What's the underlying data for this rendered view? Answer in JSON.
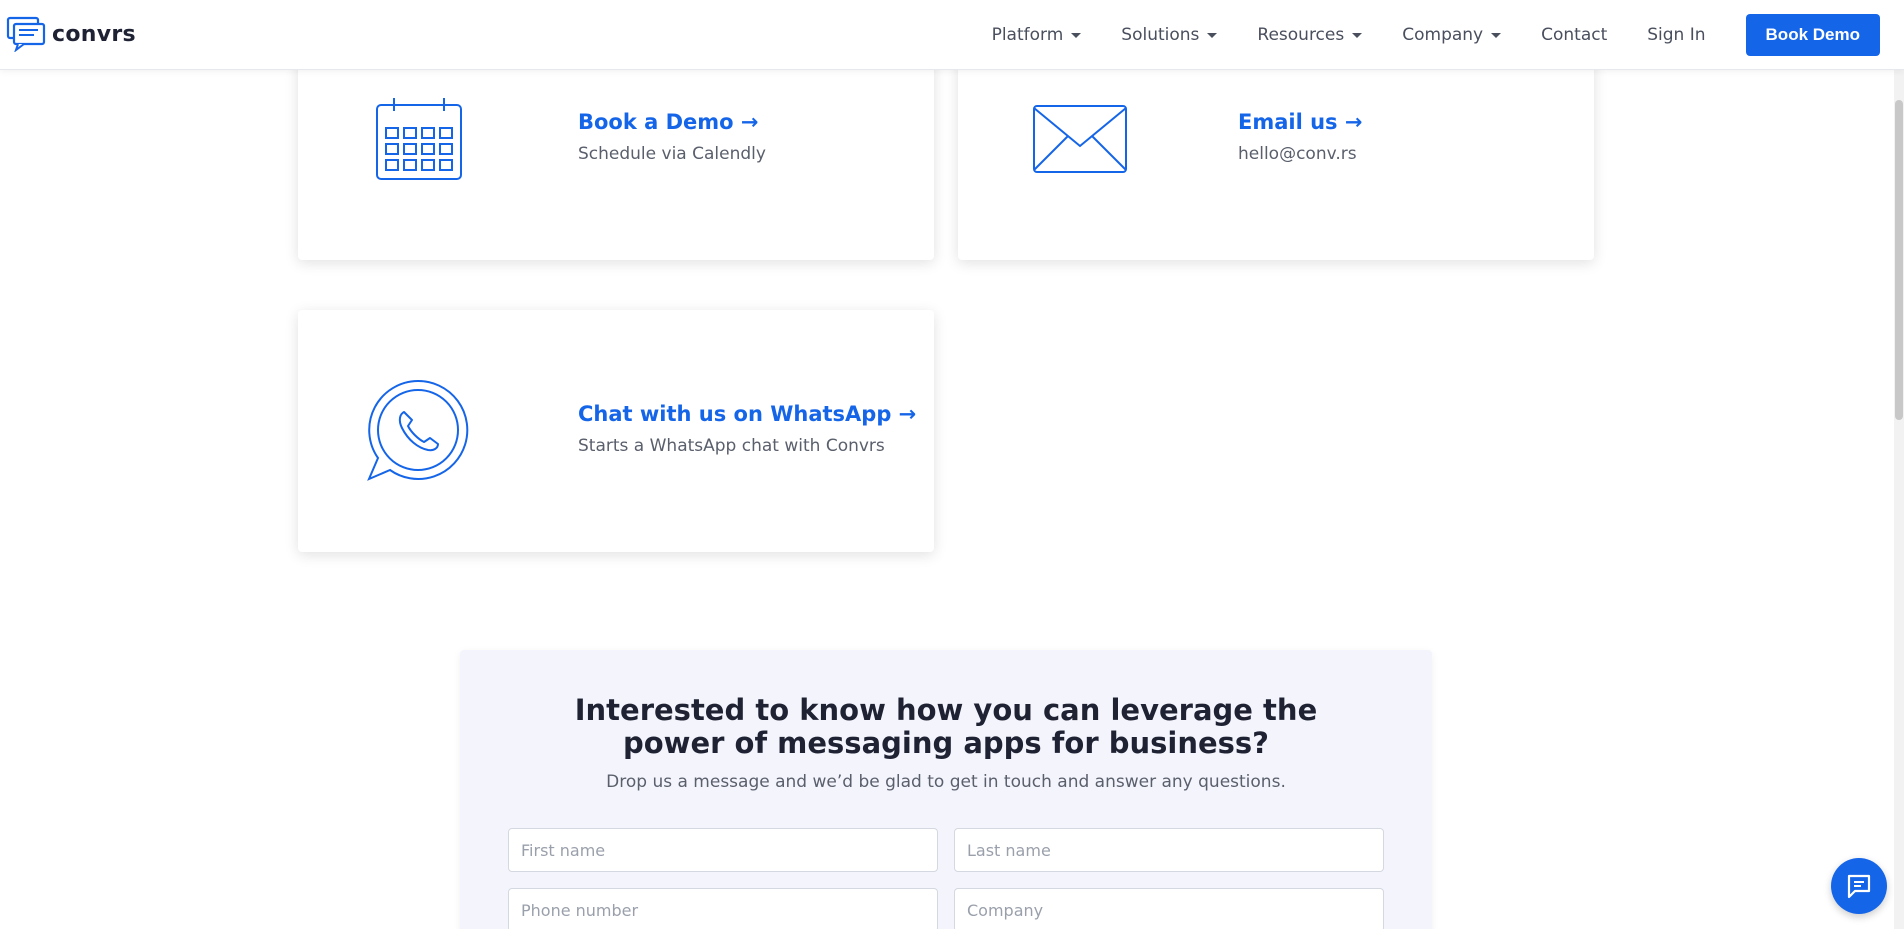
{
  "header": {
    "logo_text": "convrs",
    "nav": [
      {
        "label": "Platform",
        "dropdown": true
      },
      {
        "label": "Solutions",
        "dropdown": true
      },
      {
        "label": "Resources",
        "dropdown": true
      },
      {
        "label": "Company",
        "dropdown": true
      },
      {
        "label": "Contact",
        "dropdown": false
      },
      {
        "label": "Sign In",
        "dropdown": false
      }
    ],
    "cta_label": "Book Demo"
  },
  "cards": {
    "demo": {
      "title": "Book a Demo →",
      "subtitle": "Schedule via Calendly",
      "icon": "calendar-icon"
    },
    "email": {
      "title": "Email us →",
      "subtitle": "hello@conv.rs",
      "icon": "envelope-icon"
    },
    "whatsapp": {
      "title": "Chat with us on WhatsApp →",
      "subtitle": "Starts a WhatsApp chat with Convrs",
      "icon": "whatsapp-icon"
    }
  },
  "form": {
    "title": "Interested to know how you can leverage the power of messaging apps for business?",
    "subtitle": "Drop us a message and we’d be glad to get in touch and answer any questions.",
    "first_name_placeholder": "First name",
    "last_name_placeholder": "Last name",
    "phone_placeholder": "Phone number",
    "company_placeholder": "Company"
  },
  "colors": {
    "brand": "#1565e8",
    "text_dark": "#1e2233",
    "form_bg": "#f4f5fc"
  }
}
